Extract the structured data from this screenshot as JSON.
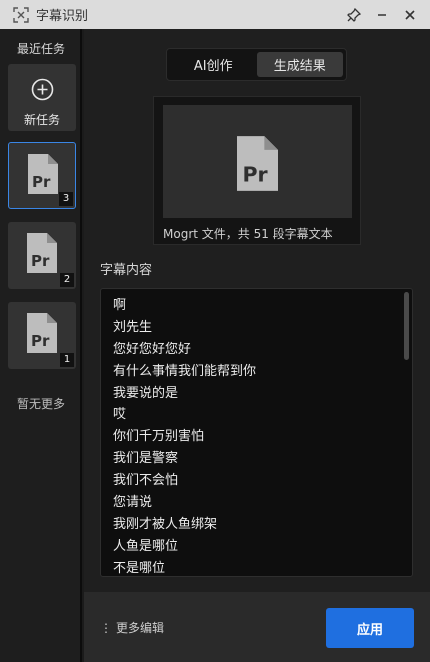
{
  "window": {
    "title": "字幕识别",
    "controls": {
      "pin": "pin-icon",
      "minimize": "minimize-icon",
      "close": "close-icon"
    }
  },
  "sidebar": {
    "heading": "最近任务",
    "new_task_label": "新任务",
    "tasks": [
      {
        "badge": "3",
        "active": true
      },
      {
        "badge": "2",
        "active": false
      },
      {
        "badge": "1",
        "active": false
      }
    ],
    "no_more": "暂无更多"
  },
  "tabs": [
    {
      "label": "AI创作",
      "selected": false
    },
    {
      "label": "生成结果",
      "selected": true
    }
  ],
  "preview": {
    "icon_text": "Pr",
    "caption": "Mogrt 文件，共 51 段字幕文本"
  },
  "subtitles": {
    "title": "字幕内容",
    "lines": [
      "啊",
      "刘先生",
      "您好您好您好",
      "有什么事情我们能帮到你",
      "我要说的是",
      "哎",
      "你们千万别害怕",
      "我们是警察",
      "我们不会怕",
      "您请说",
      "我刚才被人鱼绑架",
      "人鱼是哪位",
      "不是哪位"
    ]
  },
  "footer": {
    "more_edit": "更多编辑",
    "apply": "应用"
  },
  "colors": {
    "accent": "#1f6fe0",
    "active_border": "#3a86e6"
  }
}
